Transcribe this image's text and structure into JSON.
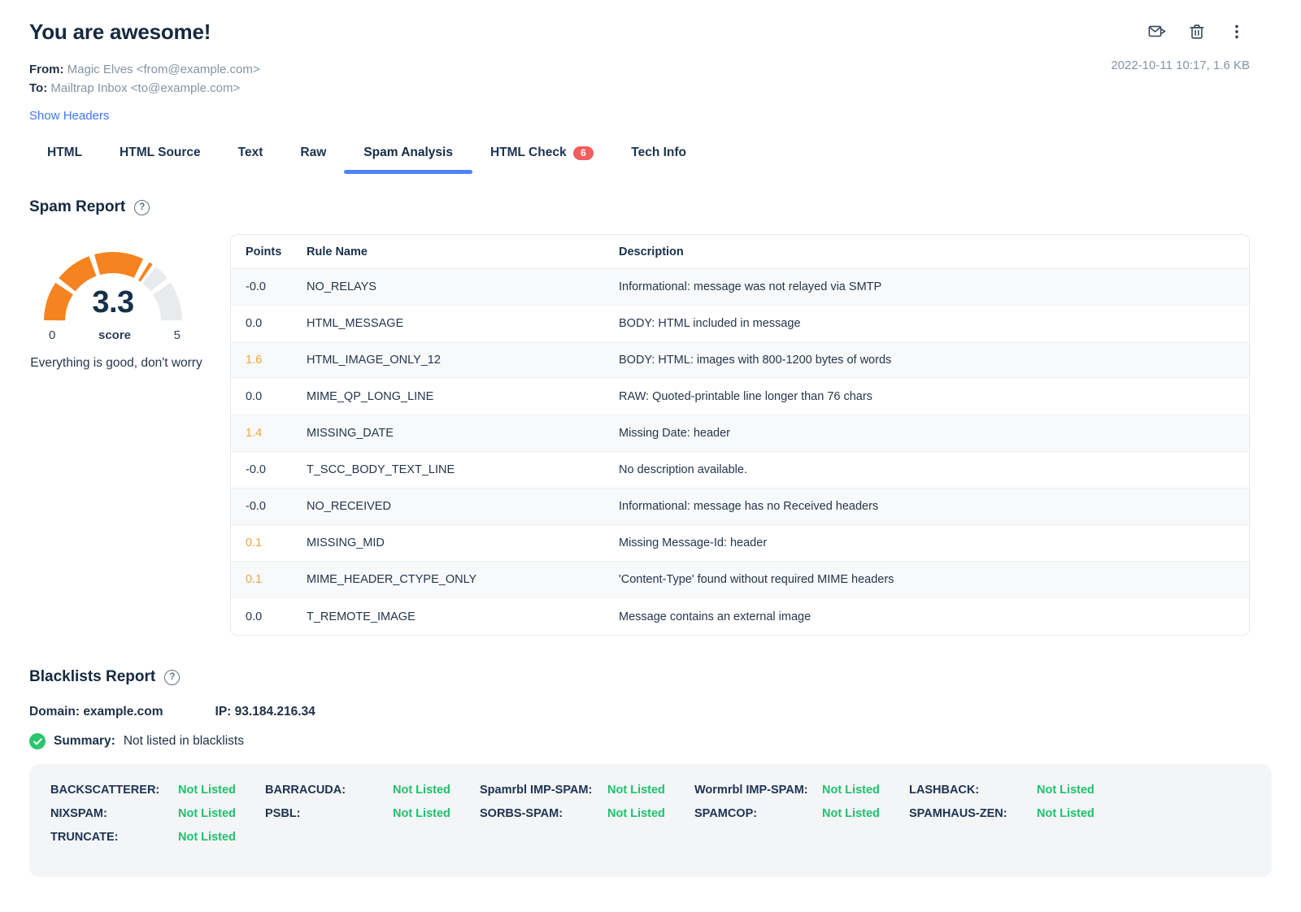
{
  "colors": {
    "accent_blue": "#5083f7",
    "link_blue": "#3d78f2",
    "badge_red": "#f15e5e",
    "gauge_orange": "#f5831f",
    "gauge_empty": "#e9eaec",
    "points_amber": "#f2a33c",
    "success_green": "#1ec16c",
    "navy_text": "#1e3048",
    "secondary_gray": "#8394a5"
  },
  "header": {
    "title": "You are awesome!",
    "from_label": "From:",
    "from_value": "Magic Elves <from@example.com>",
    "to_label": "To:",
    "to_value": "Mailtrap Inbox <to@example.com>",
    "show_headers": "Show Headers",
    "meta": "2022-10-11 10:17, 1.6 KB",
    "icons": [
      "forward-email-icon",
      "delete-icon",
      "more-options-icon"
    ]
  },
  "tabs": {
    "items": [
      {
        "label": "HTML",
        "active": false
      },
      {
        "label": "HTML Source",
        "active": false
      },
      {
        "label": "Text",
        "active": false
      },
      {
        "label": "Raw",
        "active": false
      },
      {
        "label": "Spam Analysis",
        "active": true
      },
      {
        "label": "HTML Check",
        "active": false,
        "badge": "6"
      },
      {
        "label": "Tech Info",
        "active": false
      }
    ]
  },
  "spam_report": {
    "heading": "Spam Report",
    "help_glyph": "?"
  },
  "chart_data": {
    "type": "gauge",
    "score": 3.3,
    "min": 0,
    "max": 5,
    "min_label": "0",
    "score_label": "score",
    "max_label": "5",
    "caption": "Everything is good, don't worry",
    "segment_boundaries": [
      0.2,
      0.4,
      0.8
    ],
    "filled_color": "#f5831f",
    "empty_color": "#e9eaec"
  },
  "spam_table": {
    "columns": [
      "Points",
      "Rule Name",
      "Description"
    ],
    "rows": [
      {
        "points": "-0.0",
        "rule": "NO_RELAYS",
        "description": "Informational: message was not relayed via SMTP",
        "highlight": false
      },
      {
        "points": "0.0",
        "rule": "HTML_MESSAGE",
        "description": "BODY: HTML included in message",
        "highlight": false
      },
      {
        "points": "1.6",
        "rule": "HTML_IMAGE_ONLY_12",
        "description": "BODY: HTML: images with 800-1200 bytes of words",
        "highlight": true
      },
      {
        "points": "0.0",
        "rule": "MIME_QP_LONG_LINE",
        "description": "RAW: Quoted-printable line longer than 76 chars",
        "highlight": false
      },
      {
        "points": "1.4",
        "rule": "MISSING_DATE",
        "description": "Missing Date: header",
        "highlight": true
      },
      {
        "points": "-0.0",
        "rule": "T_SCC_BODY_TEXT_LINE",
        "description": "No description available.",
        "highlight": false
      },
      {
        "points": "-0.0",
        "rule": "NO_RECEIVED",
        "description": "Informational: message has no Received headers",
        "highlight": false
      },
      {
        "points": "0.1",
        "rule": "MISSING_MID",
        "description": "Missing Message-Id: header",
        "highlight": true
      },
      {
        "points": "0.1",
        "rule": "MIME_HEADER_CTYPE_ONLY",
        "description": "'Content-Type' found without required MIME headers",
        "highlight": true
      },
      {
        "points": "0.0",
        "rule": "T_REMOTE_IMAGE",
        "description": "Message contains an external image",
        "highlight": false
      }
    ]
  },
  "blacklists": {
    "heading": "Blacklists Report",
    "domain_label": "Domain:",
    "domain": "example.com",
    "ip_label": "IP:",
    "ip": "93.184.216.34",
    "summary_label": "Summary:",
    "summary_value": "Not listed in blacklists",
    "columns": [
      [
        {
          "label": "BACKSCATTERER:",
          "value": "Not Listed"
        },
        {
          "label": "NIXSPAM:",
          "value": "Not Listed"
        },
        {
          "label": "TRUNCATE:",
          "value": "Not Listed"
        }
      ],
      [
        {
          "label": "BARRACUDA:",
          "value": "Not Listed"
        },
        {
          "label": "PSBL:",
          "value": "Not Listed"
        }
      ],
      [
        {
          "label": "Spamrbl IMP-SPAM:",
          "value": "Not Listed"
        },
        {
          "label": "SORBS-SPAM:",
          "value": "Not Listed"
        }
      ],
      [
        {
          "label": "Wormrbl IMP-SPAM:",
          "value": "Not Listed"
        },
        {
          "label": "SPAMCOP:",
          "value": "Not Listed"
        }
      ],
      [
        {
          "label": "LASHBACK:",
          "value": "Not Listed"
        },
        {
          "label": "SPAMHAUS-ZEN:",
          "value": "Not Listed"
        }
      ]
    ]
  }
}
